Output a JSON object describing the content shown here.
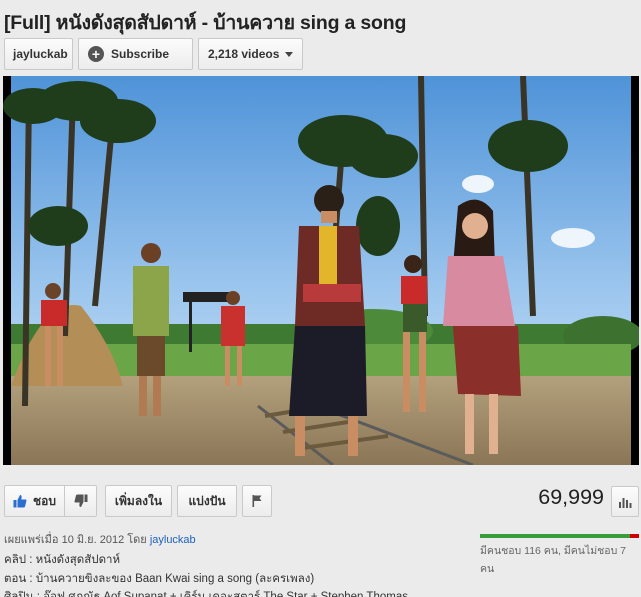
{
  "video": {
    "title": "[Full] หนังดังสุดสัปดาห์ - บ้านควาย sing a song"
  },
  "channel": {
    "name": "jayluckab",
    "subscribe_label": "Subscribe",
    "videos_count": "2,218 videos"
  },
  "actions": {
    "like_label": "ชอบ",
    "add_to_label": "เพิ่มลงใน",
    "share_label": "แบ่งปัน"
  },
  "views": "69,999",
  "published": {
    "prefix": "เผยแพร่เมื่อ 10 มิ.ย. 2012 โดย ",
    "author": "jayluckab"
  },
  "description": [
    "คลิป : หนังดังสุดสัปดาห์",
    "ตอน : บ้านควายขิงละของ Baan Kwai sing a song (ละครเพลง)",
    "ศิลปิน : อ๊อฟ ศุภณัฐ Aof Supanat + เคิร์น เดอะสตาร์ The Star + Stephen Thomas"
  ],
  "ratings": {
    "like_fraction": 0.943,
    "summary": "มีคนชอบ 116 คน, มีคนไม่ชอบ 7 คน"
  },
  "colors": {
    "like_bar": "#3a9b3a",
    "dislike_bar": "#cc0000",
    "link": "#1c62b9"
  },
  "icons": [
    "plus-icon",
    "caret-down-icon",
    "thumbs-up-icon",
    "thumbs-down-icon",
    "flag-icon",
    "stats-icon"
  ]
}
